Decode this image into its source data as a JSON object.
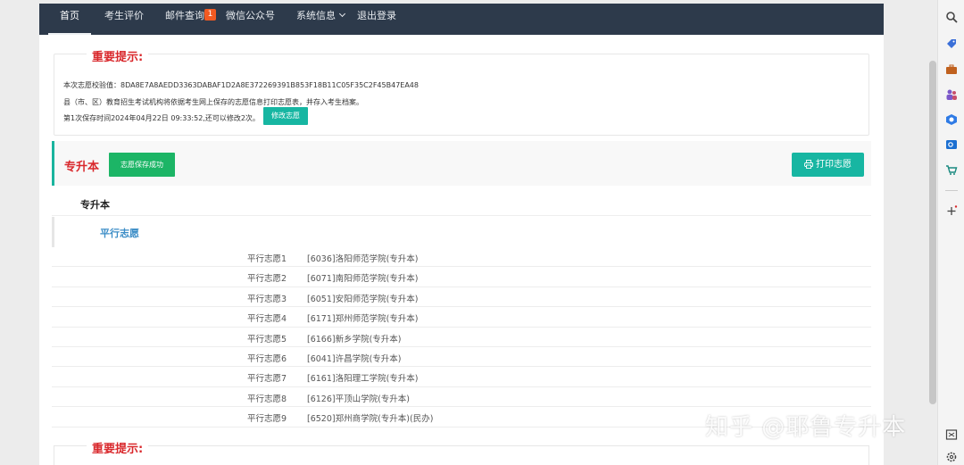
{
  "nav": {
    "items": [
      "首页",
      "考生评价",
      "邮件查询",
      "微信公众号",
      "系统信息",
      "退出登录"
    ],
    "mail_badge": "1"
  },
  "notice": {
    "legend": "重要提示:",
    "line1": "本次志愿校验值：8DA8E7A8AEDD3363DABAF1D2A8E372269391B853F18B11C05F35C2F45B47EA48",
    "line2": "县（市、区）教育招生考试机构将依据考生网上保存的志愿信息打印志愿表，并存入考生档案。",
    "line3": "第1次保存时间2024年04月22日 09:33:52,还可以修改2次。",
    "modify_button": "修改志愿"
  },
  "section": {
    "title": "专升本",
    "save_badge": "志愿保存成功",
    "print_button": "打印志愿",
    "type_label": "专升本",
    "sub_label": "平行志愿"
  },
  "wishes": [
    {
      "key": "平行志愿1",
      "value": "[6036]洛阳师范学院(专升本)"
    },
    {
      "key": "平行志愿2",
      "value": "[6071]南阳师范学院(专升本)"
    },
    {
      "key": "平行志愿3",
      "value": "[6051]安阳师范学院(专升本)"
    },
    {
      "key": "平行志愿4",
      "value": "[6171]郑州师范学院(专升本)"
    },
    {
      "key": "平行志愿5",
      "value": "[6166]新乡学院(专升本)"
    },
    {
      "key": "平行志愿6",
      "value": "[6041]许昌学院(专升本)"
    },
    {
      "key": "平行志愿7",
      "value": "[6161]洛阳理工学院(专升本)"
    },
    {
      "key": "平行志愿8",
      "value": "[6126]平顶山学院(专升本)"
    },
    {
      "key": "平行志愿9",
      "value": "[6520]郑州商学院(专升本)(民办)"
    }
  ],
  "notice2": {
    "legend": "重要提示:"
  },
  "watermark": "知乎 @耶鲁专升本",
  "icons": [
    "search-icon",
    "tag-icon",
    "briefcase-icon",
    "people-icon",
    "office-icon",
    "outlook-icon",
    "cart-icon",
    "plus-icon",
    "window-icon",
    "gear-icon",
    "printer-icon"
  ],
  "colors": {
    "nav_bg": "#2d3a4b",
    "accent_teal": "#17b6a2",
    "success_green": "#1cb566",
    "warning_red": "#d9282c",
    "link_blue": "#3a8cc6"
  }
}
